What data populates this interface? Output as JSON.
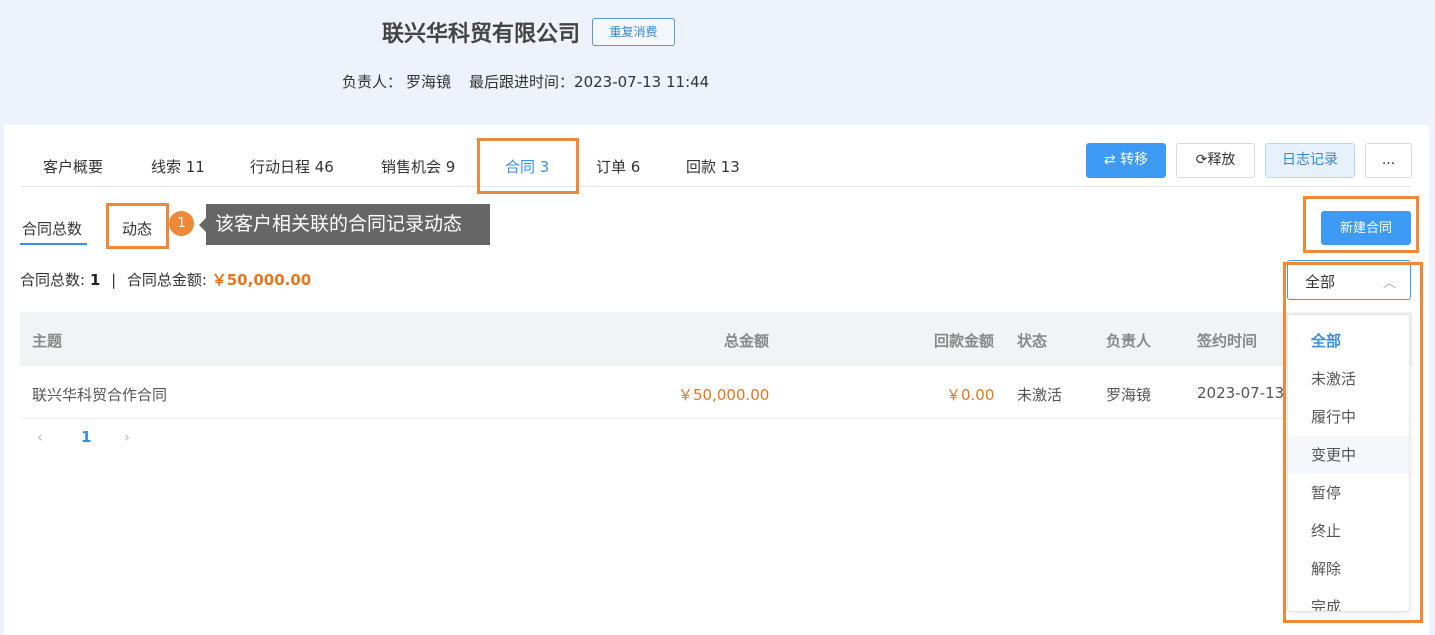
{
  "header": {
    "company": "联兴华科贸有限公司",
    "repeat_tag": "重复消费",
    "owner_label": "负责人：",
    "owner": "罗海镜",
    "last_follow_label": "最后跟进时间：",
    "last_follow": "2023-07-13 11:44"
  },
  "tabs": [
    "客户概要",
    "线索 11",
    "行动日程 46",
    "销售机会 9",
    "合同 3",
    "订单 6",
    "回款 13"
  ],
  "actions": {
    "transfer": "转移",
    "release": "释放",
    "log": "日志记录",
    "more": "..."
  },
  "subtabs": {
    "total": "合同总数",
    "dynamic": "动态"
  },
  "callout": {
    "number": "1",
    "text": "该客户相关联的合同记录动态"
  },
  "new_contract": "新建合同",
  "summary": {
    "count_label": "合同总数:",
    "count": "1",
    "sep": "|",
    "amount_label": "合同总金额:",
    "amount": "￥50,000.00"
  },
  "filter": {
    "value": "全部"
  },
  "table": {
    "headers": [
      "主题",
      "总金额",
      "回款金额",
      "状态",
      "负责人",
      "签约时间"
    ],
    "rows": [
      [
        "联兴华科贸合作合同",
        "￥50,000.00",
        "￥0.00",
        "未激活",
        "罗海镜",
        "2023-07-13"
      ]
    ]
  },
  "pager": {
    "prev": "‹",
    "page": "1",
    "next": "›"
  },
  "dropdown": [
    "全部",
    "未激活",
    "履行中",
    "变更中",
    "暂停",
    "终止",
    "解除",
    "完成"
  ],
  "colors": {
    "accent": "#3d9bf5",
    "highlight": "#f0883a",
    "money": "#e8761e"
  }
}
